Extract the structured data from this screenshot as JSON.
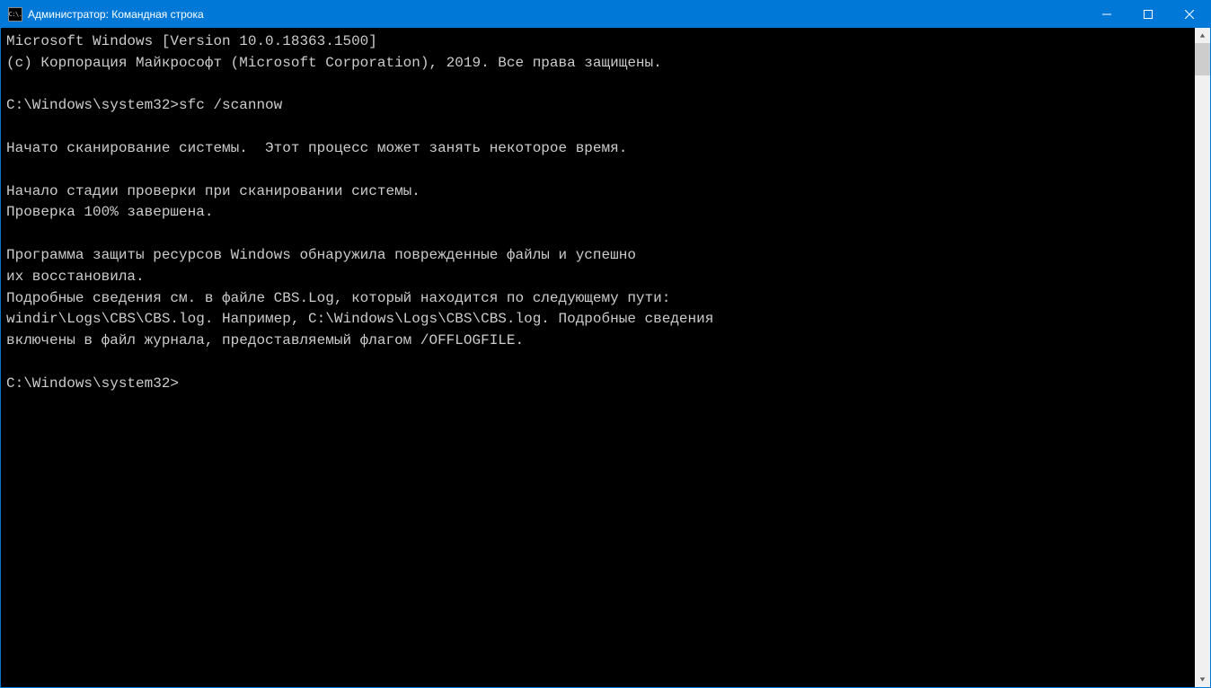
{
  "titlebar": {
    "icon_label": "C:\\.",
    "title": "Администратор: Командная строка"
  },
  "console": {
    "lines": [
      "Microsoft Windows [Version 10.0.18363.1500]",
      "(c) Корпорация Майкрософт (Microsoft Corporation), 2019. Все права защищены.",
      "",
      "C:\\Windows\\system32>sfc /scannow",
      "",
      "Начато сканирование системы.  Этот процесс может занять некоторое время.",
      "",
      "Начало стадии проверки при сканировании системы.",
      "Проверка 100% завершена.",
      "",
      "Программа защиты ресурсов Windows обнаружила поврежденные файлы и успешно",
      "их восстановила.",
      "Подробные сведения см. в файле CBS.Log, который находится по следующему пути:",
      "windir\\Logs\\CBS\\CBS.log. Например, C:\\Windows\\Logs\\CBS\\CBS.log. Подробные сведения",
      "включены в файл журнала, предоставляемый флагом /OFFLOGFILE.",
      "",
      "C:\\Windows\\system32>"
    ]
  }
}
